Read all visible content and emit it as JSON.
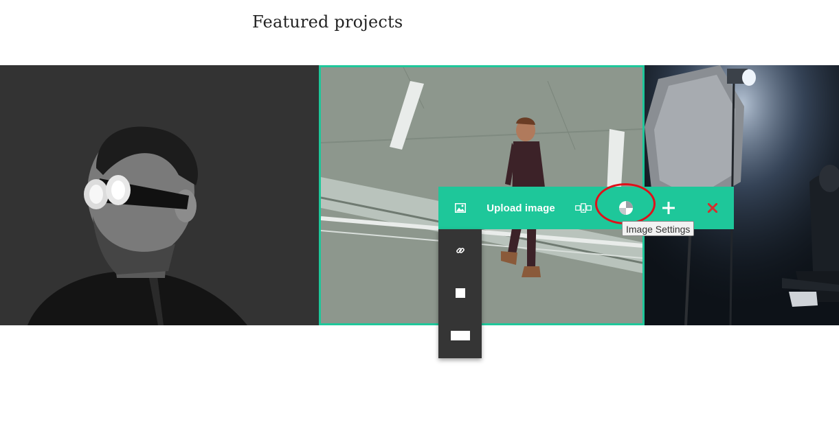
{
  "section": {
    "title": "Featured projects"
  },
  "toolbar": {
    "upload_label": "Upload image",
    "buttons": [
      "image-icon",
      "upload-image",
      "gallery-icon",
      "image-settings-icon",
      "add-icon",
      "close-icon"
    ]
  },
  "tooltip": {
    "text": "Image Settings"
  },
  "dropdown": {
    "items": [
      "link-icon",
      "square-shape-icon",
      "rectangle-shape-icon"
    ]
  },
  "colors": {
    "accent": "#1ec79a",
    "dropdown_bg": "#353535",
    "close": "#d32f2f",
    "highlight": "#e0101a"
  }
}
